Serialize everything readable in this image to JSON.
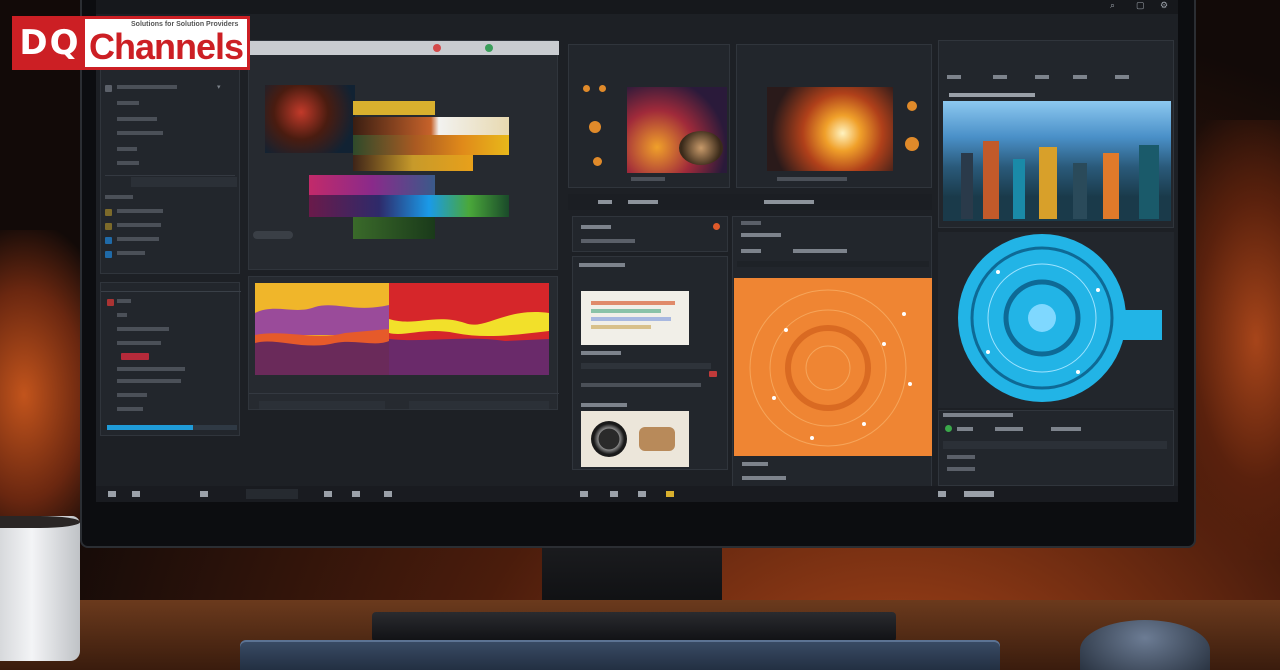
{
  "brand": {
    "letters": "DQ",
    "name": "Channels",
    "tagline": "Solutions for Solution Providers",
    "colors": {
      "red": "#cc1f24",
      "white": "#ffffff"
    }
  },
  "screen": {
    "accent": "#1f9bd8",
    "orange": "#ef8533",
    "cyan": "#22b4e6"
  }
}
